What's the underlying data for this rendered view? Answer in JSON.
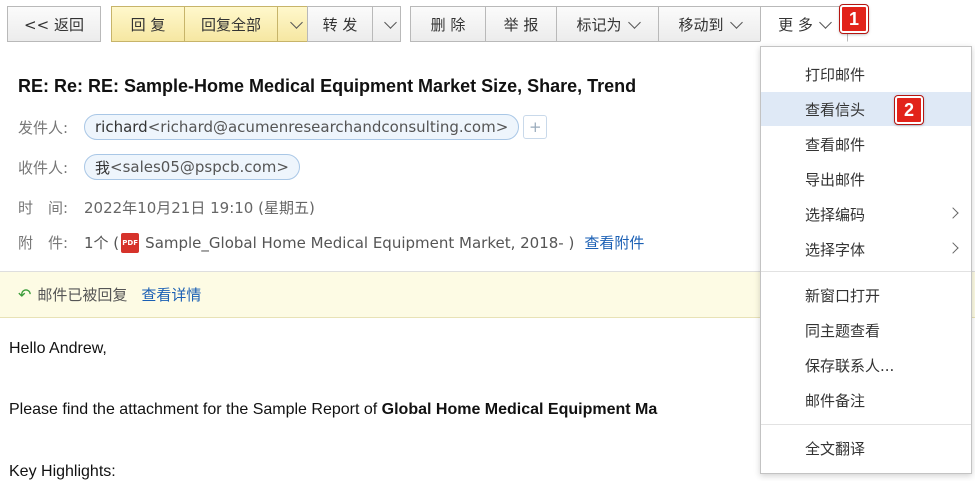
{
  "toolbar": {
    "back": "<< 返回",
    "reply": "回 复",
    "reply_all": "回复全部",
    "forward": "转 发",
    "delete": "删 除",
    "report": "举 报",
    "mark_as": "标记为",
    "move_to": "移动到",
    "more": "更 多"
  },
  "steps": {
    "one": "1",
    "two": "2"
  },
  "email": {
    "subject": "RE: Re: RE: Sample-Home Medical Equipment Market Size, Share, Trend",
    "from_label": "发件人:",
    "from_name": "richard",
    "from_addr": "<richard@acumenresearchandconsulting.com>",
    "to_label": "收件人:",
    "to_name": "我",
    "to_addr": "<sales05@pspcb.com>",
    "time_label": "时　间:",
    "time_value": "2022年10月21日 19:10 (星期五)",
    "attach_label": "附　件:",
    "attach_count": "1个 (",
    "attach_icon_text": "PDF",
    "attach_name": "Sample_Global Home Medical Equipment Market, 2018- )",
    "attach_view": "查看附件"
  },
  "notice": {
    "text": "邮件已被回复",
    "link": "查看详情"
  },
  "body": {
    "greeting": "Hello Andrew,",
    "line1_prefix": "Please find the attachment for the Sample Report of ",
    "line1_bold": "Global Home Medical Equipment Ma",
    "line2": "Key Highlights:"
  },
  "menu": {
    "print": "打印邮件",
    "view_header": "查看信头",
    "view_mail": "查看邮件",
    "export": "导出邮件",
    "encoding": "选择编码",
    "font": "选择字体",
    "new_window": "新窗口打开",
    "same_topic": "同主题查看",
    "save_contact": "保存联系人...",
    "note": "邮件备注",
    "translate": "全文翻译"
  }
}
